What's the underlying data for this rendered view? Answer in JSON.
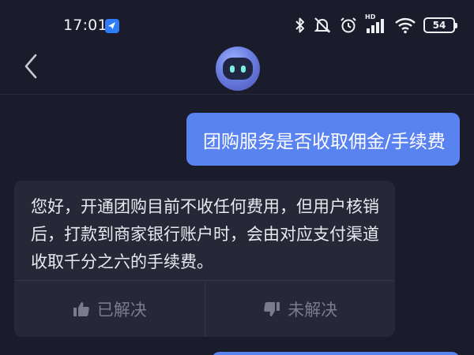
{
  "status_bar": {
    "time": "17:01",
    "app_badge_icon": "feishu-app-icon",
    "network_label": "HD",
    "battery_level": "54"
  },
  "header": {
    "back_icon": "chevron-left-icon",
    "avatar_icon": "robot-avatar-icon"
  },
  "conversation": {
    "user_message": "团购服务是否收取佣金/手续费",
    "bot_reply": "您好，开通团购目前不收任何费用，但用户核销后，打款到商家银行账户时，会由对应支付渠道收取千分之六的手续费。",
    "feedback": {
      "resolved_label": "已解决",
      "unresolved_label": "未解决"
    }
  },
  "colors": {
    "background": "#1b1c2b",
    "user_bubble": "#5a83f2",
    "bot_bubble": "#262838",
    "muted_text": "#7a7c8c"
  }
}
